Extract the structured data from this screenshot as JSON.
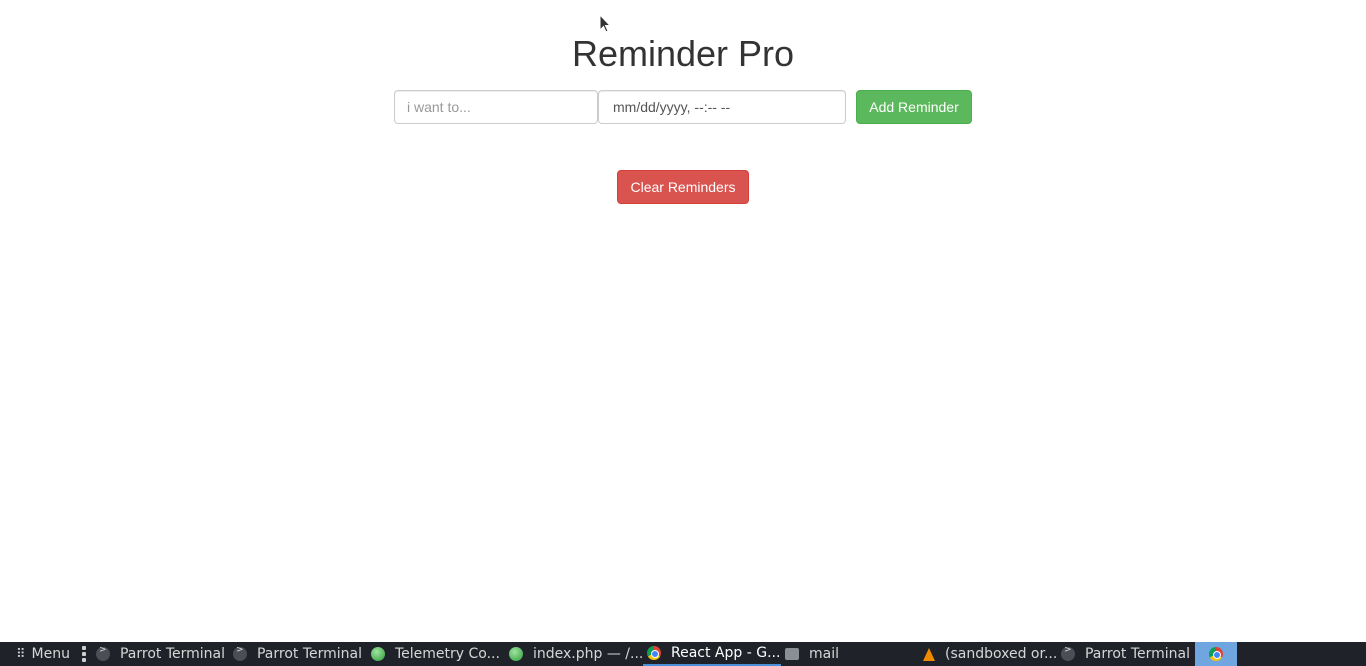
{
  "app": {
    "title": "Reminder Pro",
    "reminder_input": {
      "placeholder": "i want to...",
      "value": ""
    },
    "date_input": {
      "value": "mm/dd/yyyy, --:-- --"
    },
    "add_button_label": "Add Reminder",
    "clear_button_label": "Clear Reminders",
    "colors": {
      "add": "#5cb85c",
      "clear": "#d9534f"
    }
  },
  "taskbar": {
    "menu_label": "Menu",
    "items": [
      {
        "label": "Parrot Terminal",
        "icon": "terminal-icon"
      },
      {
        "label": "Parrot Terminal",
        "icon": "terminal-icon"
      },
      {
        "label": "Telemetry Co...",
        "icon": "app-icon"
      },
      {
        "label": "index.php — /...",
        "icon": "app-icon"
      },
      {
        "label": "React App - G...",
        "icon": "chrome-icon",
        "active": true
      },
      {
        "label": "mail",
        "icon": "folder-icon"
      },
      {
        "label": "(sandboxed or...",
        "icon": "vlc-icon"
      },
      {
        "label": "Parrot Terminal",
        "icon": "terminal-icon"
      }
    ],
    "tray_icon": "chrome-icon"
  }
}
